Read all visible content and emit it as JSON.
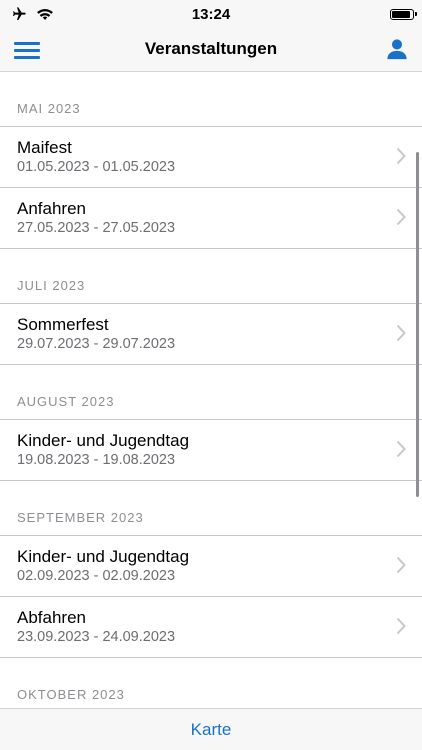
{
  "status_bar": {
    "time": "13:24"
  },
  "nav": {
    "title": "Veranstaltungen"
  },
  "sections": [
    {
      "header": "MAI 2023",
      "events": [
        {
          "title": "Maifest",
          "dates": "01.05.2023 - 01.05.2023"
        },
        {
          "title": "Anfahren",
          "dates": "27.05.2023 - 27.05.2023"
        }
      ]
    },
    {
      "header": "JULI 2023",
      "events": [
        {
          "title": "Sommerfest",
          "dates": "29.07.2023 - 29.07.2023"
        }
      ]
    },
    {
      "header": "AUGUST 2023",
      "events": [
        {
          "title": "Kinder- und Jugendtag",
          "dates": "19.08.2023 - 19.08.2023"
        }
      ]
    },
    {
      "header": "SEPTEMBER 2023",
      "events": [
        {
          "title": "Kinder- und Jugendtag",
          "dates": "02.09.2023 - 02.09.2023"
        },
        {
          "title": "Abfahren",
          "dates": "23.09.2023 - 24.09.2023"
        }
      ]
    },
    {
      "header": "OKTOBER 2023",
      "events": []
    }
  ],
  "bottom_bar": {
    "label": "Karte"
  },
  "colors": {
    "accent": "#1a72c8",
    "secondary_text": "#6d6d72",
    "section_text": "#8e8e93"
  }
}
